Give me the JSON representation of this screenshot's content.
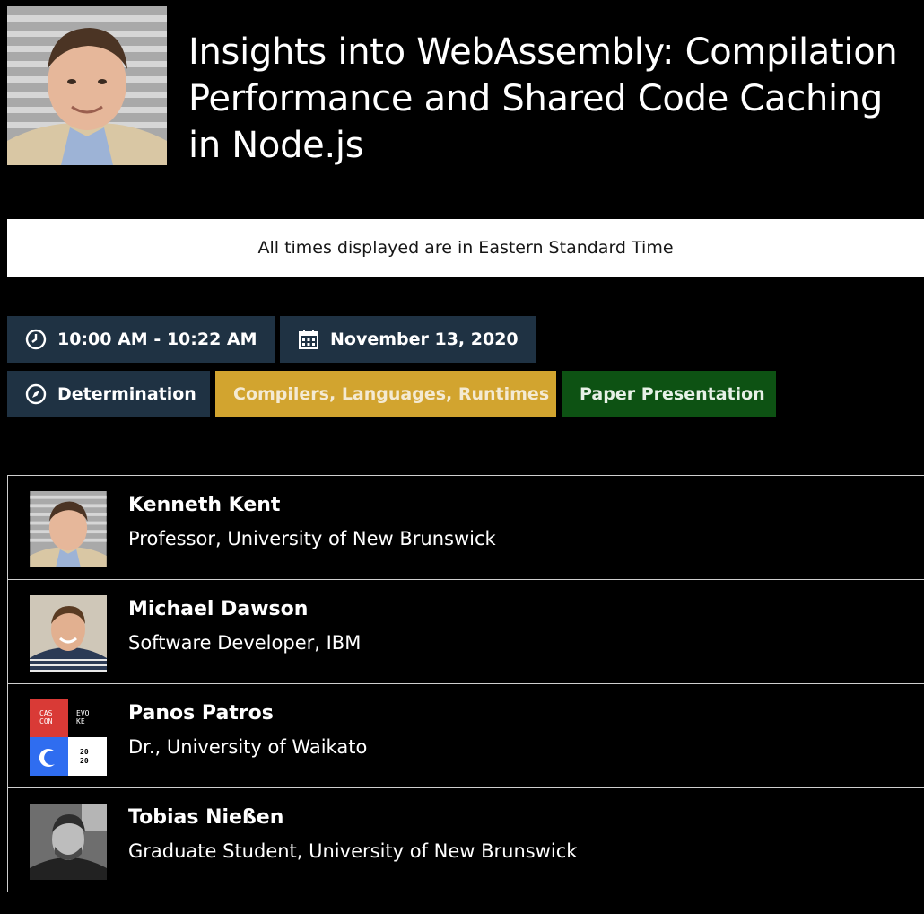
{
  "session": {
    "title": "Insights into WebAssembly: Compilation Performance and Shared Code Caching in Node.js"
  },
  "timezone_notice": "All times displayed are in Eastern Standard Time",
  "chips": {
    "time": "10:00 AM - 10:22 AM",
    "date": "November 13, 2020",
    "track": "Determination",
    "topic": "Compilers, Languages, Runtimes",
    "type": "Paper Presentation"
  },
  "speakers": [
    {
      "name": "Kenneth Kent",
      "role": "Professor, University of New Brunswick"
    },
    {
      "name": "Michael Dawson",
      "role": "Software Developer, IBM"
    },
    {
      "name": "Panos Patros",
      "role": "Dr., University of Waikato",
      "logo": {
        "cas": "CAS",
        "con": "CON",
        "evo": "EVO",
        "ke": "KE",
        "y1": "20",
        "y2": "20"
      }
    },
    {
      "name": "Tobias Nießen",
      "role": "Graduate Student, University of New Brunswick"
    }
  ],
  "colors": {
    "chip_dark": "#1f3243",
    "chip_topic": "#d2a42f",
    "chip_type": "#0d5213",
    "logo_red": "#d93a36",
    "logo_blue": "#2f6df0"
  }
}
